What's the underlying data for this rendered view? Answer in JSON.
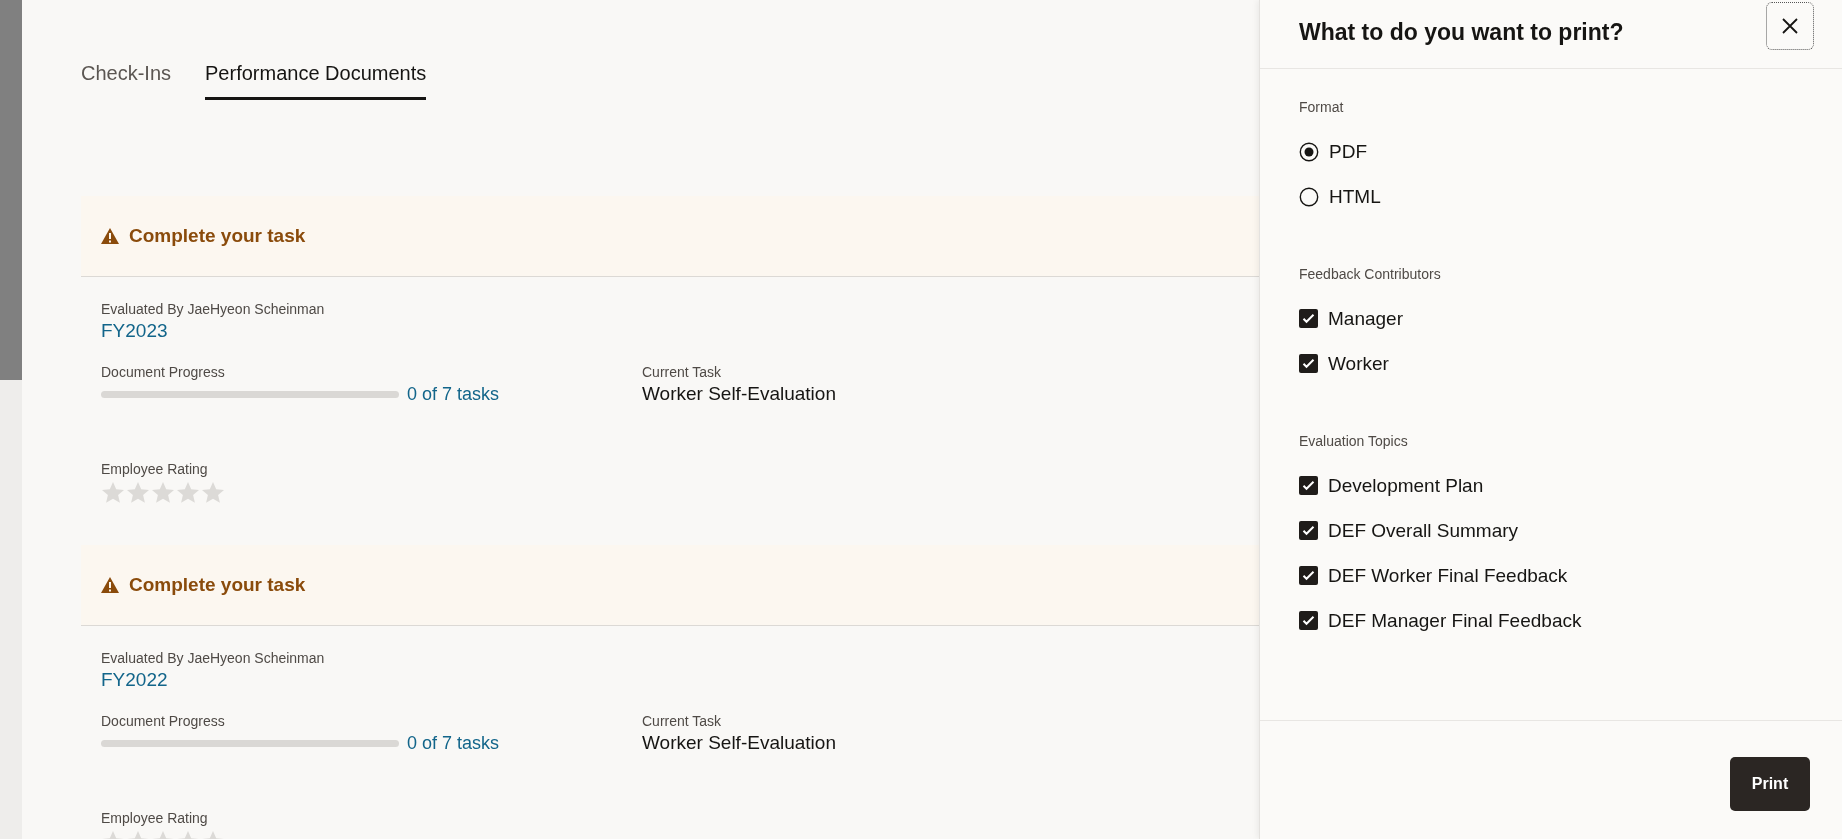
{
  "tabs": [
    {
      "label": "Check-Ins",
      "selected": false
    },
    {
      "label": "Performance Documents",
      "selected": true
    }
  ],
  "documents": [
    {
      "alert": "Complete your task",
      "evaluated_by": "Evaluated By JaeHyeon Scheinman",
      "title": "FY2023",
      "progress_label": "Document Progress",
      "progress": {
        "level": 0,
        "reading": "0 of 7 tasks"
      },
      "current_task_label": "Current Task",
      "current_task": "Worker Self-Evaluation",
      "rating_label": "Employee Rating",
      "stars": 0
    },
    {
      "alert": "Complete your task",
      "evaluated_by": "Evaluated By JaeHyeon Scheinman",
      "title": "FY2022",
      "progress_label": "Document Progress",
      "progress": {
        "level": 0,
        "reading": "0 of 7 tasks"
      },
      "current_task_label": "Current Task",
      "current_task": "Worker Self-Evaluation",
      "rating_label": "Employee Rating",
      "stars": 0
    }
  ],
  "print_panel": {
    "title": "What to do you want to print?",
    "sections": [
      {
        "label": "Format",
        "kind": "radio",
        "options": [
          {
            "label": "PDF",
            "selected": true
          },
          {
            "label": "HTML",
            "selected": false
          }
        ]
      },
      {
        "label": "Feedback Contributors",
        "kind": "checkbox",
        "options": [
          {
            "label": "Manager",
            "checked": true
          },
          {
            "label": "Worker",
            "checked": true
          }
        ]
      },
      {
        "label": "Evaluation Topics",
        "kind": "checkbox",
        "options": [
          {
            "label": "Development Plan",
            "checked": true
          },
          {
            "label": "DEF Overall Summary",
            "checked": true
          },
          {
            "label": "DEF Worker Final Feedback",
            "checked": true
          },
          {
            "label": "DEF Manager Final Feedback",
            "checked": true
          }
        ]
      }
    ],
    "button": "Print"
  }
}
